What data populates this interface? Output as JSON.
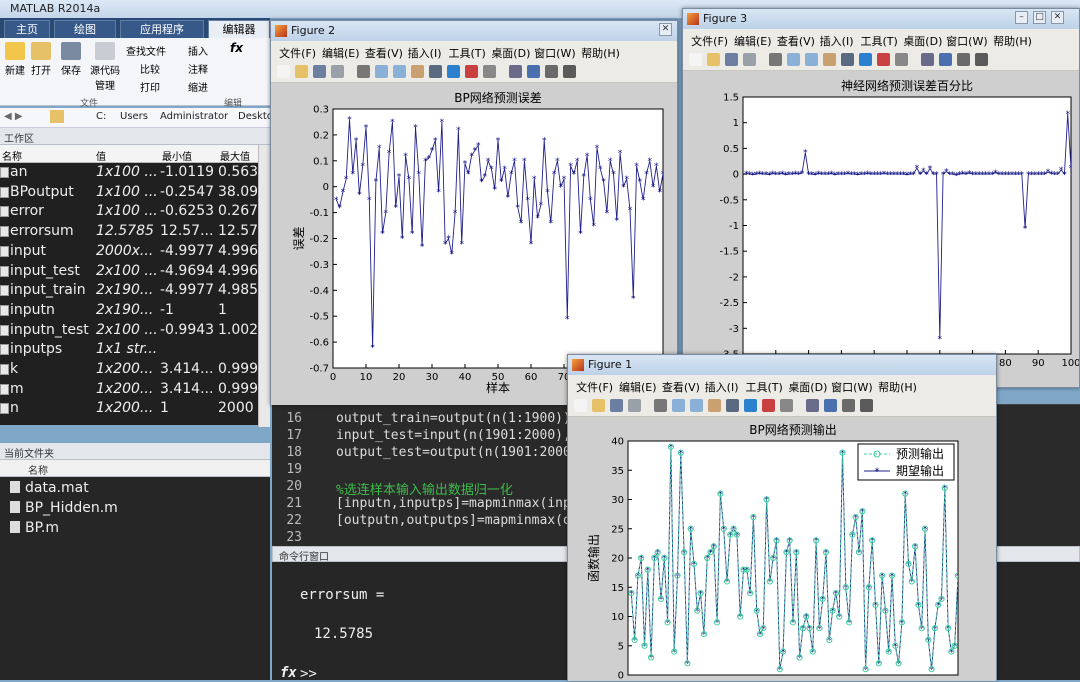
{
  "app": {
    "title": "MATLAB R2014a"
  },
  "ribbon": {
    "tabs": [
      "主页",
      "绘图",
      "应用程序",
      "编辑器"
    ],
    "buttons": [
      "新建",
      "打开",
      "保存",
      "源代码管理"
    ],
    "small": [
      "查找文件",
      "比较",
      "打印",
      "插入",
      "注释",
      "缩进"
    ],
    "fx": "fx",
    "sections": [
      "文件",
      "编辑"
    ]
  },
  "address": {
    "parts": [
      "C:",
      "Users",
      "Administrator",
      "Desktop"
    ]
  },
  "workspace": {
    "title": "工作区",
    "columns": [
      "名称",
      "值",
      "最小值",
      "最大值"
    ],
    "rows": [
      [
        "an",
        "1x100 ...",
        "-1.0119",
        "0.563..."
      ],
      [
        "BPoutput",
        "1x100 ...",
        "-0.2547",
        "38.092"
      ],
      [
        "error",
        "1x100 ...",
        "-0.6253",
        "0.2675"
      ],
      [
        "errorsum",
        "12.5785",
        "12.57...",
        "12.57..."
      ],
      [
        "input",
        "2000x...",
        "-4.9977",
        "4.996..."
      ],
      [
        "input_test",
        "2x100 ...",
        "-4.9694",
        "4.996..."
      ],
      [
        "input_train",
        "2x190...",
        "-4.9977",
        "4.985..."
      ],
      [
        "inputn",
        "2x190...",
        "-1",
        "1"
      ],
      [
        "inputn_test",
        "2x100 ...",
        "-0.9943",
        "1.002..."
      ],
      [
        "inputps",
        "1x1 str...",
        "",
        ""
      ],
      [
        "k",
        "1x200...",
        "3.414...",
        "0.9999"
      ],
      [
        "m",
        "1x200...",
        "3.414...",
        "0.9999"
      ],
      [
        "n",
        "1x200...",
        "1",
        "2000"
      ]
    ]
  },
  "files": {
    "title": "当前文件夹",
    "col": "名称",
    "items": [
      "data.mat",
      "BP_Hidden.m",
      "BP.m"
    ]
  },
  "editor": {
    "lines": [
      {
        "n": "16",
        "code": "output_train=output(n(1:1900));",
        "comment": false
      },
      {
        "n": "17",
        "code": "input_test=input(n(1901:2000),",
        "comment": false
      },
      {
        "n": "18",
        "code": "output_test=output(n(1901:2000)",
        "comment": false
      },
      {
        "n": "19",
        "code": "",
        "comment": false
      },
      {
        "n": "20",
        "code": "%选连样本输入输出数据归一化",
        "comment": true
      },
      {
        "n": "21",
        "code": "[inputn,inputps]=mapminmax(inpu",
        "comment": false
      },
      {
        "n": "22",
        "code": "[outputn,outputps]=mapminmax(ou",
        "comment": false
      },
      {
        "n": "23",
        "code": "",
        "comment": false
      }
    ]
  },
  "command": {
    "title": "命令行窗口",
    "var": "errorsum =",
    "value": "12.5785",
    "prompt": ">>",
    "fx": "fx"
  },
  "figure_menu": [
    "文件(F)",
    "编辑(E)",
    "查看(V)",
    "插入(I)",
    "工具(T)",
    "桌面(D)",
    "窗口(W)",
    "帮助(H)"
  ],
  "figures": {
    "fig1": "Figure 1",
    "fig2": "Figure 2",
    "fig3": "Figure 3"
  },
  "colors": {
    "line": "#20208a",
    "marker": "#0a0a80",
    "predict": "#3fd0a0",
    "desktop": "#7fa7c8"
  },
  "chart_data": [
    {
      "type": "line",
      "title": "BP网络预测误差",
      "xlabel": "样本",
      "ylabel": "误差",
      "xlim": [
        0,
        100
      ],
      "ylim": [
        -0.7,
        0.3
      ],
      "xticks": [
        "0",
        "10",
        "20",
        "30",
        "40",
        "50",
        "60",
        "70"
      ],
      "yticks": [
        "0.3",
        "0.2",
        "0.1",
        "0",
        "-0.1",
        "-0.2",
        "-0.3",
        "-0.4",
        "-0.5",
        "-0.6",
        "-0.7"
      ],
      "series": [
        {
          "marker": "*",
          "values": [
            -0.05,
            -0.08,
            -0.02,
            0.03,
            0.26,
            0.05,
            0.18,
            -0.03,
            0.08,
            0.23,
            -0.05,
            -0.62,
            0.02,
            0.15,
            -0.18,
            -0.1,
            0.13,
            0.25,
            -0.08,
            0.04,
            -0.2,
            0.12,
            0.03,
            -0.18,
            0.23,
            0.05,
            -0.23,
            0.1,
            0.11,
            0.14,
            0.18,
            -0.02,
            0.25,
            -0.22,
            -0.2,
            -0.26,
            -0.1,
            0.22,
            -0.22,
            0.09,
            0.05,
            0.12,
            0.14,
            0.16,
            0.02,
            0.04,
            0.1,
            0.07,
            -0.01,
            0.18,
            0.02,
            0.07,
            -0.04,
            0.05,
            0.1,
            -0.08,
            -0.14,
            0.1,
            -0.05,
            -0.22,
            0.03,
            -0.12,
            -0.07,
            0.18,
            -0.02,
            -0.14,
            0.05,
            0.1,
            0.0,
            0.03,
            -0.51,
            0.08,
            0.05,
            0.1,
            -0.18,
            0.04,
            0.12,
            -0.05,
            -0.15,
            0.15,
            0.07,
            0.02,
            -0.1,
            0.1,
            0.05,
            -0.13,
            0.13,
            0.0,
            0.03,
            -0.09,
            -0.43,
            0.08,
            0.02,
            -0.05,
            0.05,
            0.1,
            0.0,
            0.08,
            -0.02,
            0.05
          ]
        }
      ]
    },
    {
      "type": "line",
      "title": "神经网络预测误差百分比",
      "xlabel": "",
      "ylabel": "",
      "xlim": [
        0,
        100
      ],
      "ylim": [
        -3.5,
        1.5
      ],
      "xticks": [
        "0",
        "10",
        "20",
        "30",
        "40",
        "50",
        "60",
        "70",
        "80",
        "90",
        "100"
      ],
      "yticks": [
        "1.5",
        "1",
        "0.5",
        "0",
        "-0.5",
        "-1",
        "-1.5",
        "-2",
        "-2.5",
        "-3",
        "-3.5"
      ],
      "series": [
        {
          "marker": "*",
          "values": [
            0.01,
            0.0,
            -0.01,
            0.0,
            0.01,
            0.0,
            0.0,
            -0.01,
            0.01,
            0.0,
            0.0,
            0.01,
            -0.01,
            0.0,
            0.0,
            0.01,
            0.0,
            0.02,
            0.42,
            0.0,
            0.0,
            -0.01,
            0.01,
            0.0,
            0.0,
            0.0,
            0.01,
            -0.01,
            0.0,
            0.0,
            0.0,
            0.01,
            0.0,
            0.0,
            -0.01,
            0.0,
            0.0,
            0.01,
            0.0,
            0.0,
            0.0,
            0.0,
            0.01,
            0.0,
            0.0,
            0.0,
            0.0,
            0.0,
            0.0,
            -0.01,
            0.0,
            0.0,
            0.12,
            0.0,
            0.06,
            0.0,
            0.11,
            0.0,
            0.0,
            -3.2,
            0.0,
            0.05,
            0.0,
            0.0,
            -0.02,
            0.0,
            0.01,
            0.0,
            0.02,
            0.0,
            0.0,
            0.0,
            0.0,
            0.0,
            0.0,
            0.0,
            0.03,
            0.0,
            0.0,
            0.0,
            0.0,
            0.0,
            0.0,
            0.0,
            0.0,
            -1.05,
            0.0,
            0.0,
            0.0,
            0.0,
            0.0,
            0.0,
            0.04,
            0.01,
            0.0,
            0.0,
            0.08,
            0.0,
            1.17,
            0.12,
            0.0
          ]
        }
      ]
    },
    {
      "type": "line",
      "title": "BP网络预测输出",
      "xlabel": "",
      "ylabel": "函数输出",
      "xlim": [
        0,
        100
      ],
      "ylim": [
        0,
        40
      ],
      "yticks": [
        "40",
        "35",
        "30",
        "25",
        "20",
        "15",
        "10",
        "5",
        "0"
      ],
      "legend": "top-right",
      "series": [
        {
          "name": "预测输出",
          "marker": "o",
          "values": [
            14,
            6,
            17,
            20,
            5,
            18,
            3,
            20,
            21,
            13,
            20,
            9,
            39,
            4,
            17,
            38,
            21,
            2,
            25,
            19,
            11,
            14,
            7,
            20,
            21,
            22,
            9,
            31,
            25,
            16,
            24,
            25,
            24,
            10,
            18,
            18,
            14,
            27,
            11,
            7,
            8,
            30,
            16,
            20,
            23,
            1,
            4,
            21,
            23,
            9,
            21,
            3,
            8,
            10,
            8,
            4,
            23,
            8,
            13,
            21,
            6,
            11,
            14,
            10,
            38,
            15,
            9,
            24,
            27,
            21,
            28,
            1,
            15,
            23,
            12,
            2,
            17,
            11,
            4,
            17,
            5,
            2,
            9,
            31,
            19,
            16,
            22,
            12,
            8,
            25,
            6,
            1,
            8,
            12,
            13,
            32,
            8,
            4,
            5,
            17
          ]
        },
        {
          "name": "期望输出",
          "marker": "*",
          "values": [
            14,
            6,
            17,
            20,
            5,
            18,
            3,
            20,
            21,
            13,
            20,
            9,
            39,
            4,
            17,
            38,
            21,
            2,
            25,
            19,
            11,
            14,
            7,
            20,
            21,
            22,
            9,
            31,
            25,
            16,
            24,
            25,
            24,
            10,
            18,
            18,
            14,
            27,
            11,
            7,
            8,
            30,
            16,
            20,
            23,
            1,
            4,
            21,
            23,
            9,
            21,
            3,
            8,
            10,
            8,
            4,
            23,
            8,
            13,
            21,
            6,
            11,
            14,
            10,
            38,
            15,
            9,
            24,
            27,
            21,
            28,
            1,
            15,
            23,
            12,
            2,
            17,
            11,
            4,
            17,
            5,
            2,
            9,
            31,
            19,
            16,
            22,
            12,
            8,
            25,
            6,
            1,
            8,
            12,
            13,
            32,
            8,
            4,
            5,
            17
          ]
        }
      ]
    }
  ]
}
